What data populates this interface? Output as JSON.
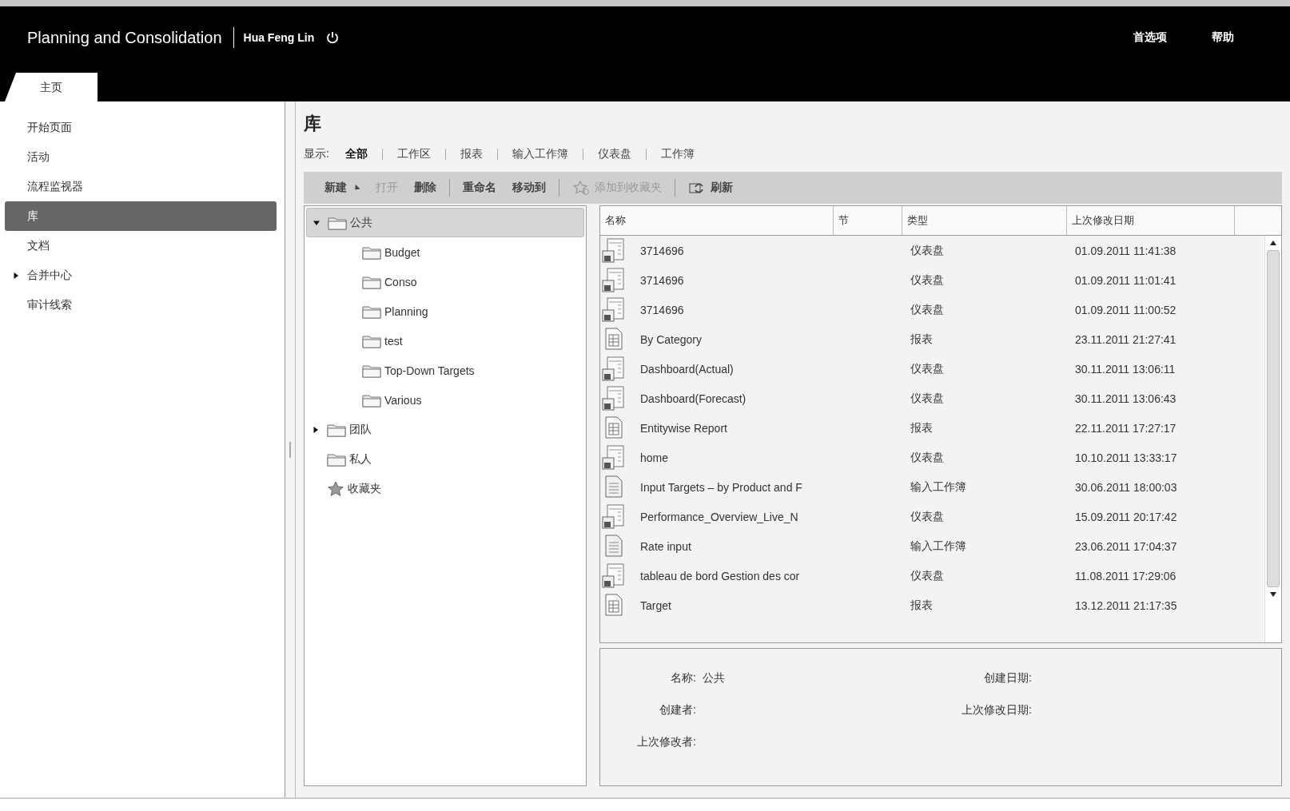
{
  "header": {
    "app_title": "Planning and Consolidation",
    "user": "Hua Feng Lin",
    "links": [
      "首选项",
      "帮助"
    ]
  },
  "tabs": [
    {
      "label": "主页",
      "selected": true
    }
  ],
  "sidebar": {
    "items": [
      {
        "label": "开始页面",
        "selected": false
      },
      {
        "label": "活动",
        "selected": false
      },
      {
        "label": "流程监视器",
        "selected": false
      },
      {
        "label": "库",
        "selected": true
      },
      {
        "label": "文档",
        "selected": false
      },
      {
        "label": "合并中心",
        "selected": false,
        "expanded": false
      },
      {
        "label": "审计线索",
        "selected": false
      }
    ]
  },
  "main": {
    "title": "库",
    "filter_label": "显示:",
    "filters": [
      {
        "label": "全部",
        "selected": true
      },
      {
        "label": "工作区",
        "selected": false
      },
      {
        "label": "报表",
        "selected": false
      },
      {
        "label": "输入工作簿",
        "selected": false
      },
      {
        "label": "仪表盘",
        "selected": false
      },
      {
        "label": "工作簿",
        "selected": false
      }
    ],
    "toolbar": [
      {
        "label": "新建",
        "kind": "menu",
        "disabled": false
      },
      {
        "label": "打开",
        "kind": "text",
        "disabled": true
      },
      {
        "label": "删除",
        "kind": "text",
        "disabled": false
      },
      {
        "kind": "separator"
      },
      {
        "label": "重命名",
        "kind": "text",
        "disabled": false
      },
      {
        "label": "移动到",
        "kind": "text",
        "disabled": false
      },
      {
        "kind": "separator"
      },
      {
        "label": "添加到收藏夹",
        "kind": "star",
        "disabled": true
      },
      {
        "kind": "separator"
      },
      {
        "label": "刷新",
        "kind": "refresh",
        "disabled": false
      }
    ],
    "tree": [
      {
        "label": "公共",
        "kind": "folder",
        "expanded": true,
        "selected": true,
        "children": [
          {
            "label": "Budget",
            "kind": "folder",
            "selected": false
          },
          {
            "label": "Conso",
            "kind": "folder",
            "selected": false
          },
          {
            "label": "Planning",
            "kind": "folder",
            "selected": false
          },
          {
            "label": "test",
            "kind": "folder",
            "selected": false
          },
          {
            "label": "Top-Down Targets",
            "kind": "folder",
            "selected": false
          },
          {
            "label": "Various",
            "kind": "folder",
            "selected": false
          }
        ]
      },
      {
        "label": "团队",
        "kind": "folder",
        "expanded": false,
        "selected": false
      },
      {
        "label": "私人",
        "kind": "folder",
        "selected": false
      },
      {
        "label": "收藏夹",
        "kind": "favorites",
        "selected": false
      }
    ],
    "table": {
      "columns": [
        "名称",
        "节",
        "类型",
        "上次修改日期"
      ],
      "rows": [
        {
          "kind": "dashboard",
          "name": "3714696",
          "type": "仪表盘",
          "modified": "01.09.2011 11:41:38"
        },
        {
          "kind": "dashboard",
          "name": "3714696",
          "type": "仪表盘",
          "modified": "01.09.2011 11:01:41"
        },
        {
          "kind": "dashboard",
          "name": "3714696",
          "type": "仪表盘",
          "modified": "01.09.2011 11:00:52"
        },
        {
          "kind": "report",
          "name": "By Category",
          "type": "报表",
          "modified": "23.11.2011 21:27:41"
        },
        {
          "kind": "dashboard",
          "name": "Dashboard(Actual)",
          "type": "仪表盘",
          "modified": "30.11.2011 13:06:11"
        },
        {
          "kind": "dashboard",
          "name": "Dashboard(Forecast)",
          "type": "仪表盘",
          "modified": "30.11.2011 13:06:43"
        },
        {
          "kind": "report",
          "name": "Entitywise Report",
          "type": "报表",
          "modified": "22.11.2011 17:27:17"
        },
        {
          "kind": "dashboard",
          "name": "home",
          "type": "仪表盘",
          "modified": "10.10.2011 13:33:17"
        },
        {
          "kind": "workbook",
          "name": "Input Targets – by Product and F",
          "type": "输入工作簿",
          "modified": "30.06.2011 18:00:03"
        },
        {
          "kind": "dashboard",
          "name": "Performance_Overview_Live_N",
          "type": "仪表盘",
          "modified": "15.09.2011 20:17:42"
        },
        {
          "kind": "workbook",
          "name": "Rate input",
          "type": "输入工作簿",
          "modified": "23.06.2011 17:04:37"
        },
        {
          "kind": "dashboard",
          "name": "tableau de bord Gestion des cor",
          "type": "仪表盘",
          "modified": "11.08.2011 17:29:06"
        },
        {
          "kind": "report",
          "name": "Target",
          "type": "报表",
          "modified": "13.12.2011 21:17:35"
        }
      ]
    },
    "details": {
      "left": [
        {
          "label": "名称:",
          "value": "公共"
        },
        {
          "label": "创建者:"
        },
        {
          "label": "上次修改者:"
        }
      ],
      "right": [
        {
          "label": "创建日期:"
        },
        {
          "label": "上次修改日期:"
        }
      ]
    }
  }
}
